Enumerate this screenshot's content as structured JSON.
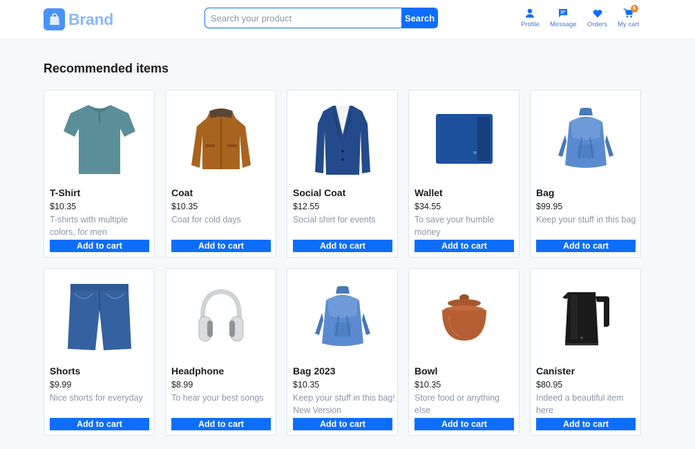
{
  "header": {
    "brand": "Brand",
    "search": {
      "placeholder": "Search your product",
      "value": "",
      "button_label": "Search"
    },
    "nav": [
      {
        "label": "Profile",
        "icon": "user-icon"
      },
      {
        "label": "Message",
        "icon": "message-icon"
      },
      {
        "label": "Orders",
        "icon": "heart-icon"
      },
      {
        "label": "My cart",
        "icon": "cart-icon",
        "badge": "6"
      }
    ]
  },
  "main": {
    "title": "Recommended items",
    "button_label": "Add to cart",
    "products": [
      {
        "name": "T-Shirt",
        "price": "$10.35",
        "description": "T-shirts with multiple colors, for men",
        "image": "tshirt"
      },
      {
        "name": "Coat",
        "price": "$10.35",
        "description": "Coat for cold days",
        "image": "coat"
      },
      {
        "name": "Social Coat",
        "price": "$12.55",
        "description": "Social shirt for events",
        "image": "blazer"
      },
      {
        "name": "Wallet",
        "price": "$34.55",
        "description": "To save your humble money",
        "image": "wallet"
      },
      {
        "name": "Bag",
        "price": "$99.95",
        "description": "Keep your stuff in this bag",
        "image": "backpack"
      },
      {
        "name": "Shorts",
        "price": "$9.99",
        "description": "Nice shorts for everyday",
        "image": "shorts"
      },
      {
        "name": "Headphone",
        "price": "$8.99",
        "description": "To hear your best songs",
        "image": "headphone"
      },
      {
        "name": "Bag 2023",
        "price": "$10.35",
        "description": "Keep your stuff in this bag! New Version",
        "image": "backpack"
      },
      {
        "name": "Bowl",
        "price": "$10.35",
        "description": "Store food or anything else",
        "image": "bowl"
      },
      {
        "name": "Canister",
        "price": "$80.95",
        "description": "Indeed a beautiful item here",
        "image": "kettle"
      }
    ]
  },
  "colors": {
    "accent": "#0d6efd",
    "brand_text": "#8cb8f7",
    "muted_text": "#8b96a5",
    "badge": "#f28b30",
    "background": "#f6f9fc"
  }
}
